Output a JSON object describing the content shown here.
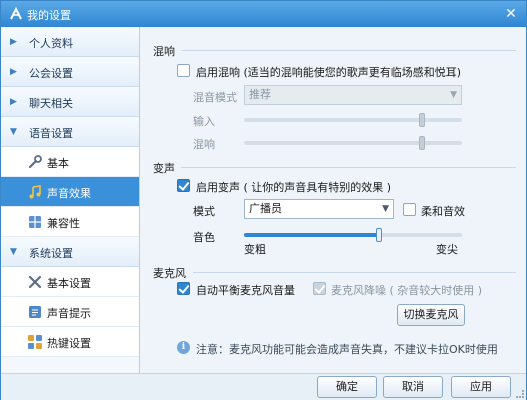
{
  "window": {
    "title": "我的设置",
    "close_glyph": "✕"
  },
  "sidebar": {
    "categories": [
      {
        "label": "个人资料",
        "arrow": "▶"
      },
      {
        "label": "公会设置",
        "arrow": "▶"
      },
      {
        "label": "聊天相关",
        "arrow": "▶"
      },
      {
        "label": "语音设置",
        "arrow": "▼"
      },
      {
        "label": "系统设置",
        "arrow": "▼"
      }
    ],
    "voice_items": [
      {
        "label": "基本",
        "icon": "wrench-icon"
      },
      {
        "label": "声音效果",
        "icon": "music-note-icon",
        "active": true
      },
      {
        "label": "兼容性",
        "icon": "grid-icon"
      }
    ],
    "system_items": [
      {
        "label": "基本设置",
        "icon": "tools-icon"
      },
      {
        "label": "声音提示",
        "icon": "note-icon"
      },
      {
        "label": "热键设置",
        "icon": "keyboard-icon"
      }
    ]
  },
  "reverb": {
    "title": "混响",
    "enable_label": "启用混响 (适当的混响能使您的歌声更有临场感和悦耳)",
    "enabled": false,
    "mode_label": "混音模式",
    "mode_value": "推荐",
    "input_label": "输入",
    "input_level": 0.8,
    "mix_label": "混响",
    "mix_level": 0.8
  },
  "voice_change": {
    "title": "变声",
    "enable_label": "启用变声 ( 让你的声音具有特别的效果 )",
    "enabled": true,
    "mode_label": "模式",
    "mode_value": "广播员",
    "soft_label": "柔和音效",
    "soft_enabled": false,
    "tone_label": "音色",
    "tone_level": 0.62,
    "tone_low": "变粗",
    "tone_high": "变尖"
  },
  "mic": {
    "title": "麦克风",
    "auto_balance_label": "自动平衡麦克风音量",
    "auto_balance": true,
    "noise_label": "麦克风降噪 ( 杂音较大时使用 )",
    "noise_enabled": true,
    "switch_button": "切换麦克风",
    "note": "注意：麦克风功能可能会造成声音失真，不建议卡拉OK时使用"
  },
  "footer": {
    "ok": "确定",
    "cancel": "取消",
    "apply": "应用"
  },
  "colors": {
    "accent": "#2f86d1",
    "titlebar": "#3a90d9",
    "active_item": "#3a90d9"
  }
}
